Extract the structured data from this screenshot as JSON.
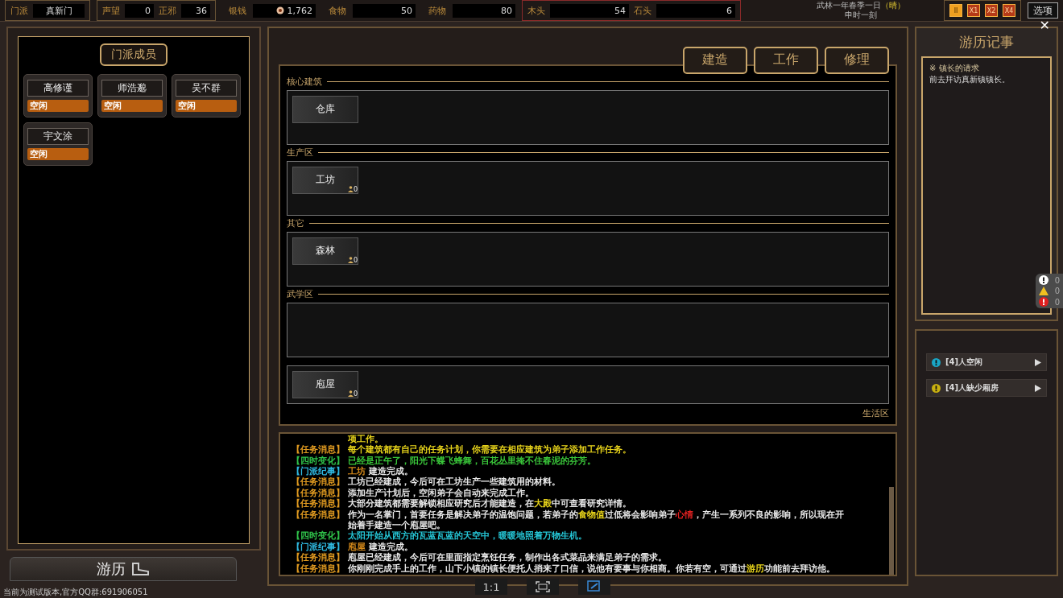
{
  "top_bar": {
    "sect": {
      "label": "门派",
      "value": "真新门"
    },
    "stats": [
      {
        "label": "声望",
        "value": "0"
      },
      {
        "label": "正邪",
        "value": "36"
      }
    ],
    "resources": [
      {
        "label": "银钱",
        "value": "1,762",
        "kind": "money"
      },
      {
        "label": "食物",
        "value": "50",
        "kind": "plain"
      },
      {
        "label": "药物",
        "value": "80",
        "kind": "plain"
      },
      {
        "label": "木头",
        "value": "54",
        "kind": "material"
      },
      {
        "label": "石头",
        "value": "6",
        "kind": "material"
      }
    ],
    "date": "武林一年春季一日",
    "weather": "（晴）",
    "time": "申时一刻",
    "speeds": [
      {
        "label": "II",
        "selected": true
      },
      {
        "label": "X1",
        "selected": false
      },
      {
        "label": "X2",
        "selected": false
      },
      {
        "label": "X4",
        "selected": false
      }
    ],
    "options_button": "选项",
    "close_button": "✕"
  },
  "members_panel": {
    "title": "门派成员",
    "members": [
      {
        "name": "高修谨",
        "status": "空闲"
      },
      {
        "name": "师浩邈",
        "status": "空闲"
      },
      {
        "name": "吴不群",
        "status": "空闲"
      },
      {
        "name": "宇文涂",
        "status": "空闲"
      }
    ],
    "travel_button": "游历"
  },
  "buildings_panel": {
    "actions": [
      "建造",
      "工作",
      "修理"
    ],
    "sections": [
      {
        "title": "核心建筑",
        "kind": "top",
        "buildings": [
          {
            "name": "仓库"
          }
        ]
      },
      {
        "title": "生产区",
        "kind": "top",
        "buildings": [
          {
            "name": "工坊",
            "workers": "0"
          }
        ]
      },
      {
        "title": "其它",
        "kind": "top",
        "buildings": [
          {
            "name": "森林",
            "workers": "0"
          }
        ]
      },
      {
        "title": "武学区",
        "kind": "top"
      },
      {
        "title": "生活区",
        "kind": "bottom",
        "buildings": [
          {
            "name": "庖屋",
            "workers": "0"
          }
        ]
      }
    ]
  },
  "log": [
    {
      "parts": [
        {
          "text": "项工作。",
          "color": "#e6d21a"
        }
      ]
    },
    {
      "tag": "【任务消息】",
      "kind": "task",
      "parts": [
        {
          "text": "每个建筑都有自己的任务计划，你需要在相应建筑为弟子添加工作任务。",
          "color": "#e6d21a"
        }
      ]
    },
    {
      "tag": "【四时变化】",
      "kind": "season",
      "parts": [
        {
          "text": "已经是正午了，阳光下蝶飞蜂舞，百花丛里掩不住春泥的芬芳。",
          "color": "#3ac73a"
        }
      ]
    },
    {
      "tag": "【门派纪事】",
      "kind": "chronicle",
      "parts": [
        {
          "text": "工坊",
          "color": "#d68a1a"
        },
        {
          "text": " 建造完成。",
          "color": "#e8e8e8"
        }
      ]
    },
    {
      "tag": "【任务消息】",
      "kind": "task",
      "parts": [
        {
          "text": "工坊已经建成，今后可在工坊生产一些建筑用的材料。",
          "color": "#e8e8e8"
        }
      ]
    },
    {
      "tag": "【任务消息】",
      "kind": "task",
      "parts": [
        {
          "text": "添加生产计划后，空闲弟子会自动来完成工作。",
          "color": "#e8e8e8"
        }
      ]
    },
    {
      "tag": "【任务消息】",
      "kind": "task",
      "parts": [
        {
          "text": "大部分建筑都需要解锁相应研究后才能建造，在",
          "color": "#e8e8e8"
        },
        {
          "text": "大殿",
          "color": "#e6d21a"
        },
        {
          "text": "中可查看研究详情。",
          "color": "#e8e8e8"
        }
      ]
    },
    {
      "tag": "【任务消息】",
      "kind": "task",
      "parts": [
        {
          "text": "作为一名掌门，首要任务是解决弟子的温饱问题，若弟子的",
          "color": "#e8e8e8"
        },
        {
          "text": "食物值",
          "color": "#e6d21a"
        },
        {
          "text": "过低将会影响弟子",
          "color": "#e8e8e8"
        },
        {
          "text": "心情",
          "color": "#e02020"
        },
        {
          "text": "，产生一系列不良的影响，所以现在开始着手建造一个庖屋吧。",
          "color": "#e8e8e8"
        }
      ]
    },
    {
      "tag": "【四时变化】",
      "kind": "season",
      "parts": [
        {
          "text": "太阳开始从西方的瓦蓝瓦蓝的天空中，暖暖地照着万物生机。",
          "color": "#25c6d6"
        }
      ]
    },
    {
      "tag": "【门派纪事】",
      "kind": "chronicle",
      "parts": [
        {
          "text": "庖屋",
          "color": "#d68a1a"
        },
        {
          "text": " 建造完成。",
          "color": "#e8e8e8"
        }
      ]
    },
    {
      "tag": "【任务消息】",
      "kind": "task",
      "parts": [
        {
          "text": "庖屋已经建成，今后可在里面指定烹饪任务，制作出各式菜品来满足弟子的需求。",
          "color": "#e8e8e8"
        }
      ]
    },
    {
      "tag": "【任务消息】",
      "kind": "task",
      "parts": [
        {
          "text": "你刚刚完成手上的工作，山下小镇的镇长便托人捎来了口信，说他有要事与你相商。你若有空，可通过",
          "color": "#e8e8e8"
        },
        {
          "text": "游历",
          "color": "#e6d21a"
        },
        {
          "text": "功能前去拜访他。",
          "color": "#e8e8e8"
        }
      ]
    }
  ],
  "journal": {
    "title": "游历记事",
    "quest_title": "※ 镇长的请求",
    "quest_text": "前去拜访真新镇镇长。"
  },
  "alert_counters": [
    {
      "kind": "info",
      "count": "0"
    },
    {
      "kind": "warning",
      "count": "0"
    },
    {
      "kind": "error",
      "count": "0"
    }
  ],
  "notices": [
    {
      "kind": "info",
      "text": "[4]人空闲"
    },
    {
      "kind": "warning",
      "text": "[4]人缺少厢房"
    }
  ],
  "view_toolbar": {
    "zoom": "1:1"
  },
  "status_text": "当前为测试版本,官方QQ群:691906051"
}
